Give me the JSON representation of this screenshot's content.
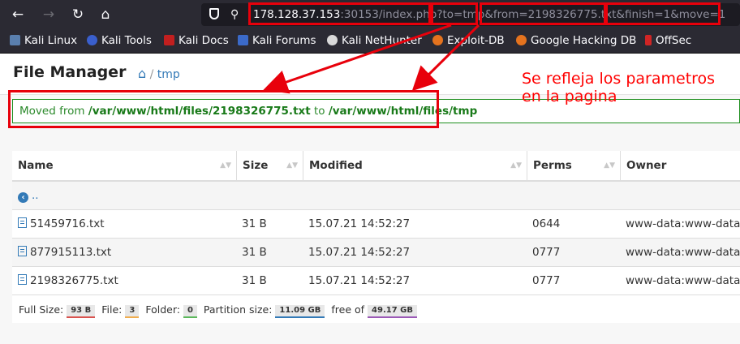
{
  "browser": {
    "url": {
      "host": "178.128.37.153",
      "rest_a": ":30153/index.php?",
      "to_param": "to=tmp",
      "amp": "&",
      "from_param": "from=2198326775.txt",
      "tail": "&finish=1&move=1"
    },
    "bookmarks": [
      "Kali Linux",
      "Kali Tools",
      "Kali Docs",
      "Kali Forums",
      "Kali NetHunter",
      "Exploit-DB",
      "Google Hacking DB",
      "OffSec"
    ]
  },
  "app": {
    "title": "File Manager",
    "breadcrumb": "tmp"
  },
  "alert": {
    "prefix": "Moved from ",
    "from_path": "/var/www/html/files/2198326775.txt",
    "mid": " to ",
    "to_path": "/var/www/html/files/tmp"
  },
  "annotation": {
    "line1": "Se refleja los parametros",
    "line2": "en la pagina"
  },
  "table": {
    "columns": [
      "Name",
      "Size",
      "Modified",
      "Perms",
      "Owner"
    ],
    "parent": "..",
    "rows": [
      {
        "name": "51459716.txt",
        "size": "31 B",
        "modified": "15.07.21 14:52:27",
        "perms": "0644",
        "owner": "www-data:www-data"
      },
      {
        "name": "877915113.txt",
        "size": "31 B",
        "modified": "15.07.21 14:52:27",
        "perms": "0777",
        "owner": "www-data:www-data"
      },
      {
        "name": "2198326775.txt",
        "size": "31 B",
        "modified": "15.07.21 14:52:27",
        "perms": "0777",
        "owner": "www-data:www-data"
      }
    ]
  },
  "footer": {
    "full_size_label": "Full Size:",
    "full_size": "93 B",
    "file_label": "File:",
    "file_count": "3",
    "folder_label": "Folder:",
    "folder_count": "0",
    "partition_label": "Partition size:",
    "partition": "11.09 GB",
    "free_label": "free of",
    "total": "49.17 GB"
  },
  "colors": {
    "annotation_red": "#e8000b",
    "alert_green": "#1e8e1e",
    "link_blue": "#337ab7"
  }
}
